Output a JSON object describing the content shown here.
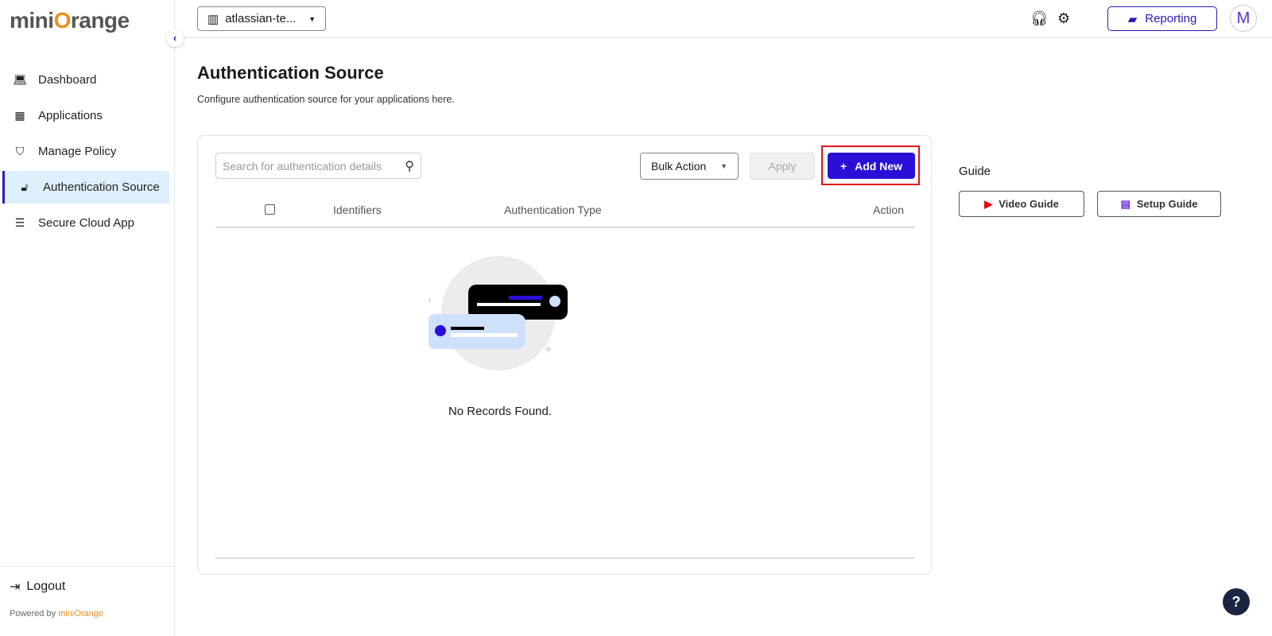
{
  "brand": {
    "logo_pre": "mini",
    "logo_o": "O",
    "logo_post": "range"
  },
  "sidebar": {
    "items": [
      {
        "label": "Dashboard",
        "icon": "laptop-icon"
      },
      {
        "label": "Applications",
        "icon": "grid-icon"
      },
      {
        "label": "Manage Policy",
        "icon": "shield-icon"
      },
      {
        "label": "Authentication Source",
        "icon": "lock-icon"
      },
      {
        "label": "Secure Cloud App",
        "icon": "list-icon"
      }
    ],
    "logout": "Logout",
    "powered_by": "Powered by",
    "powered_brand": "miniOrange"
  },
  "topbar": {
    "tenant": "atlassian-te...",
    "reporting": "Reporting",
    "avatar": "M"
  },
  "page": {
    "title": "Authentication Source",
    "subtitle": "Configure authentication source for your applications here."
  },
  "toolbar": {
    "search_placeholder": "Search for authentication details",
    "bulk_action": "Bulk Action",
    "apply": "Apply",
    "add_new": "Add New"
  },
  "table": {
    "columns": [
      "Identifiers",
      "Authentication Type",
      "Action"
    ],
    "empty": "No Records Found."
  },
  "guide": {
    "title": "Guide",
    "video": "Video Guide",
    "setup": "Setup Guide"
  },
  "colors": {
    "accent": "#2a0fd8",
    "brand_orange": "#f28c1a",
    "highlight": "#e0101a"
  }
}
